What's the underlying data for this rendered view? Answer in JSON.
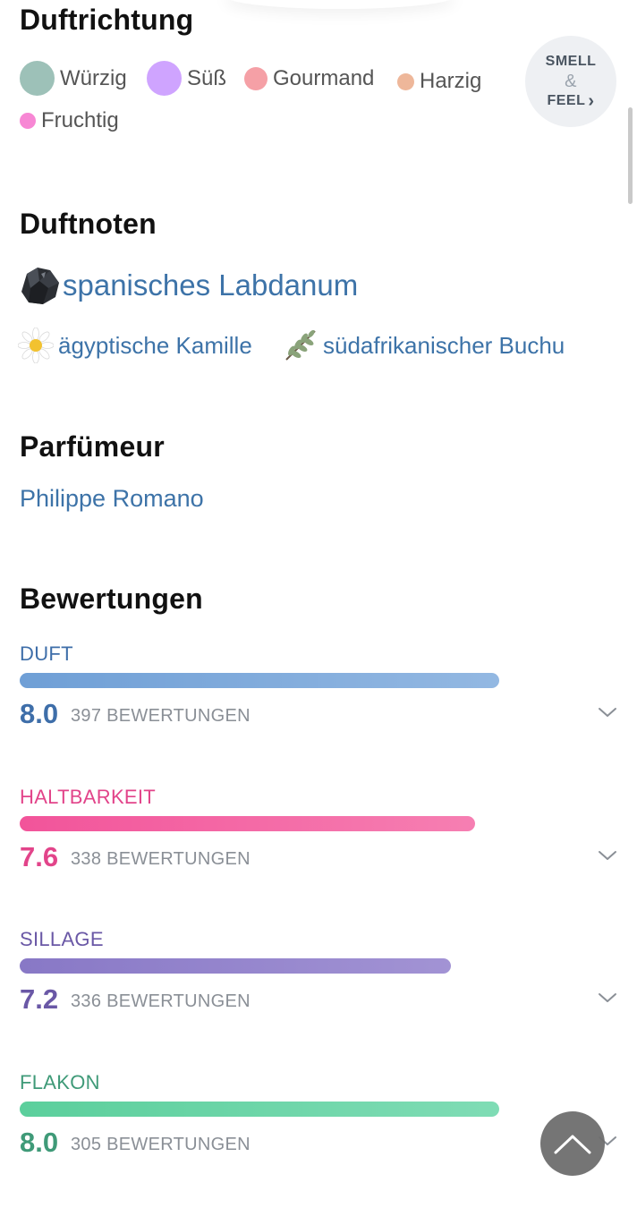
{
  "sections": {
    "duftrichtung": "Duftrichtung",
    "duftnoten": "Duftnoten",
    "parfumeur": "Parfümeur",
    "bewertungen": "Bewertungen"
  },
  "accords": [
    {
      "label": "Würzig",
      "color": "#9dc1b8"
    },
    {
      "label": "Süß",
      "color": "#cfa4ff"
    },
    {
      "label": "Gourmand",
      "color": "#f5a0a6"
    },
    {
      "label": "Harzig",
      "color": "#eeb79a"
    },
    {
      "label": "Fruchtig",
      "color": "#f787d4"
    }
  ],
  "smell_feel": {
    "line1": "SMELL",
    "amp": "&",
    "line2": "FEEL",
    "arrow": "›"
  },
  "notes": {
    "main": {
      "label": "spanisches Labdanum",
      "icon": "labdanum-icon"
    },
    "secondary": [
      {
        "label": "ägyptische Kamille",
        "icon": "chamomile-icon"
      },
      {
        "label": "südafrikanischer Buchu",
        "icon": "buchu-icon"
      }
    ]
  },
  "perfumer": "Philippe Romano",
  "ratings": [
    {
      "label": "DUFT",
      "score": "8.0",
      "count": "397 BEWERTUNGEN",
      "fraction": 0.8,
      "color": "#3e6ea9",
      "bar_from": "#6f9fd6",
      "bar_to": "#93b8e2"
    },
    {
      "label": "HALTBARKEIT",
      "score": "7.6",
      "count": "338 BEWERTUNGEN",
      "fraction": 0.76,
      "color": "#e2448a",
      "bar_from": "#f2549a",
      "bar_to": "#f67fb2"
    },
    {
      "label": "SILLAGE",
      "score": "7.2",
      "count": "336 BEWERTUNGEN",
      "fraction": 0.72,
      "color": "#6a58a6",
      "bar_from": "#8878c6",
      "bar_to": "#a293d4"
    },
    {
      "label": "FLAKON",
      "score": "8.0",
      "count": "305 BEWERTUNGEN",
      "fraction": 0.8,
      "color": "#3f9a78",
      "bar_from": "#5bcf9c",
      "bar_to": "#7fdcb5"
    }
  ],
  "colors": {
    "link": "#3d73a8",
    "fab": "#6e6e6e"
  }
}
